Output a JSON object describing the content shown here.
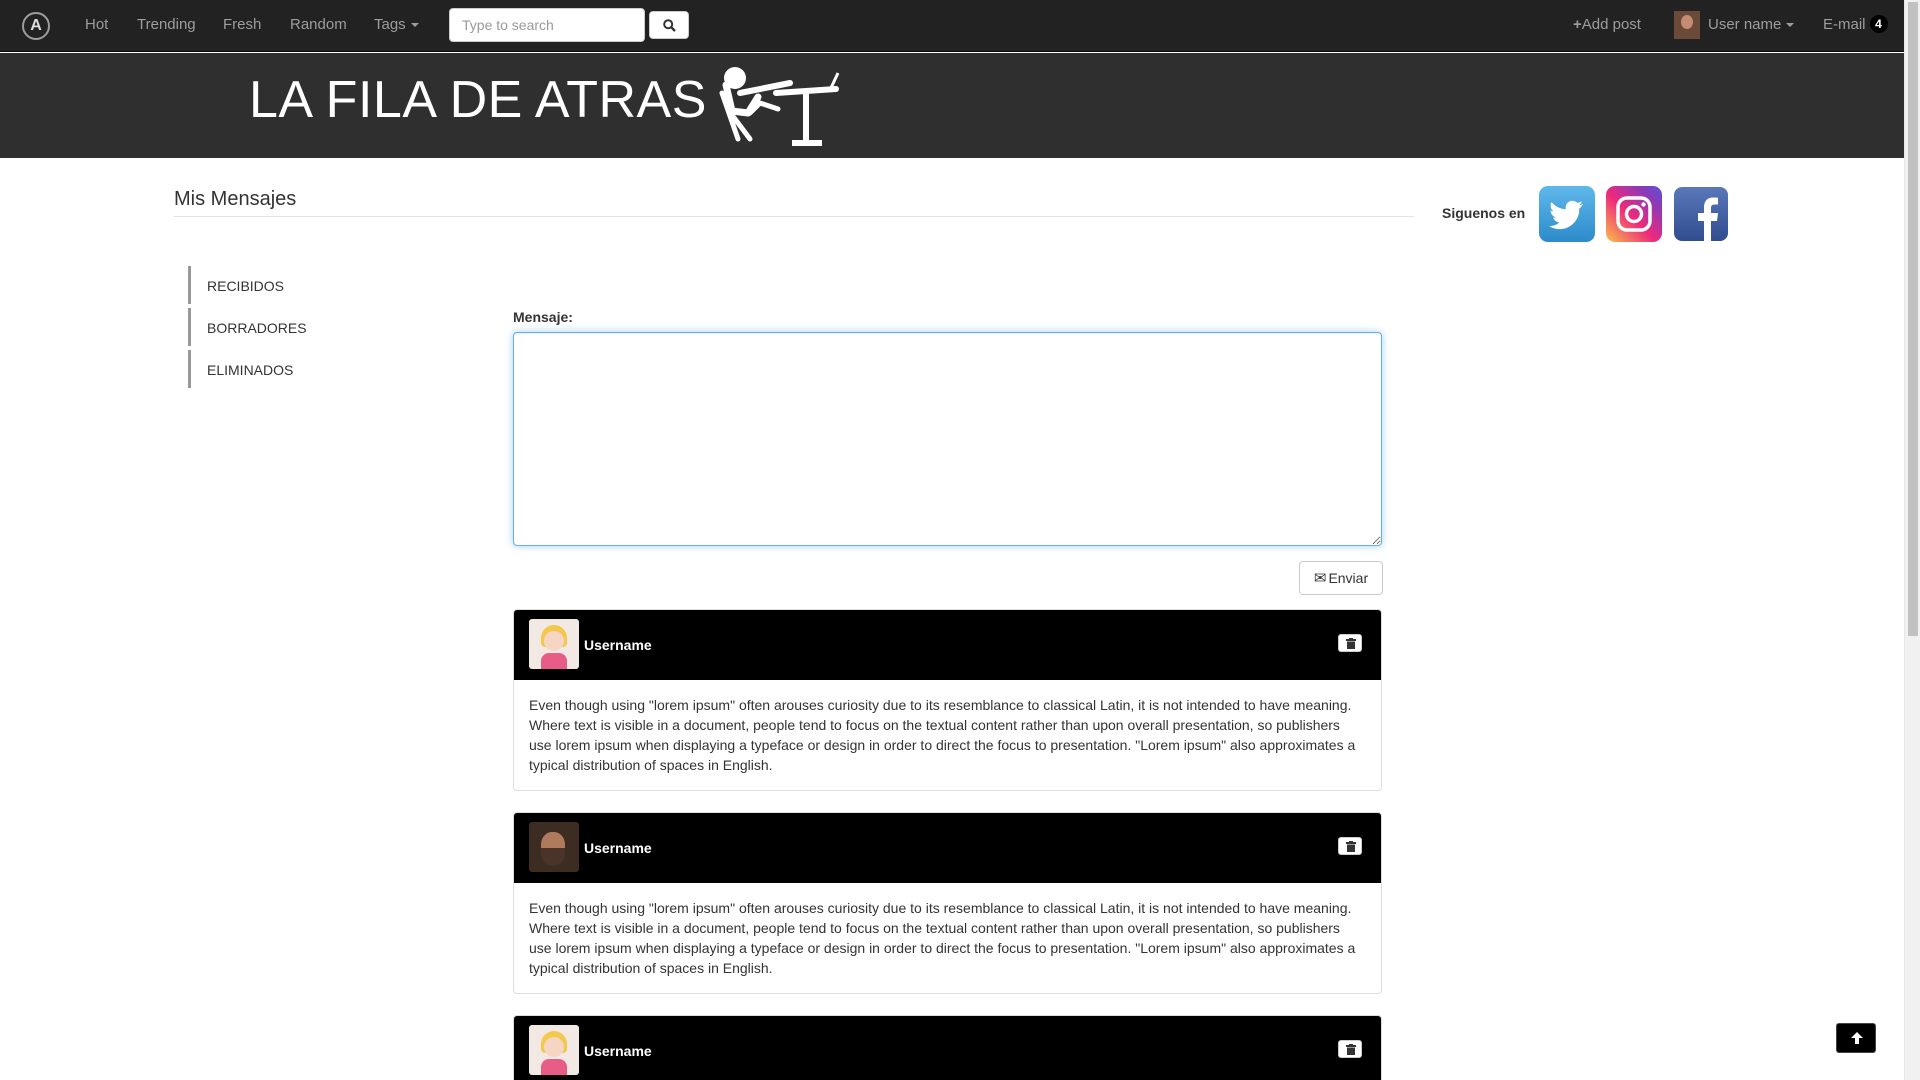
{
  "navbar": {
    "brand_glyph": "A",
    "links": [
      "Hot",
      "Trending",
      "Fresh",
      "Random"
    ],
    "tags_label": "Tags",
    "search_placeholder": "Type to search",
    "add_post_label": "Add post",
    "user_name_label": "User name",
    "email_label": "E-mail",
    "email_count": "4"
  },
  "banner": {
    "title": "LA FILA DE ATRAS"
  },
  "page": {
    "title": "Mis Mensajes",
    "follow_label": "Siguenos en",
    "social_icons": [
      "twitter-icon",
      "instagram-icon",
      "facebook-icon"
    ]
  },
  "sidebar": {
    "items": [
      "RECIBIDOS",
      "BORRADORES",
      "ELIMINADOS"
    ]
  },
  "compose": {
    "label": "Mensaje:",
    "value": "",
    "send_label": "Enviar"
  },
  "messages": [
    {
      "username": "Username",
      "avatar": "girl",
      "text": "Even though using \"lorem ipsum\" often arouses curiosity due to its resemblance to classical Latin, it is not intended to have meaning. Where text is visible in a document, people tend to focus on the textual content rather than upon overall presentation, so publishers use lorem ipsum when displaying a typeface or design in order to direct the focus to presentation. \"Lorem ipsum\" also approximates a typical distribution of spaces in English."
    },
    {
      "username": "Username",
      "avatar": "man",
      "text": "Even though using \"lorem ipsum\" often arouses curiosity due to its resemblance to classical Latin, it is not intended to have meaning. Where text is visible in a document, people tend to focus on the textual content rather than upon overall presentation, so publishers use lorem ipsum when displaying a typeface or design in order to direct the focus to presentation. \"Lorem ipsum\" also approximates a typical distribution of spaces in English."
    },
    {
      "username": "Username",
      "avatar": "girl",
      "text": ""
    }
  ]
}
